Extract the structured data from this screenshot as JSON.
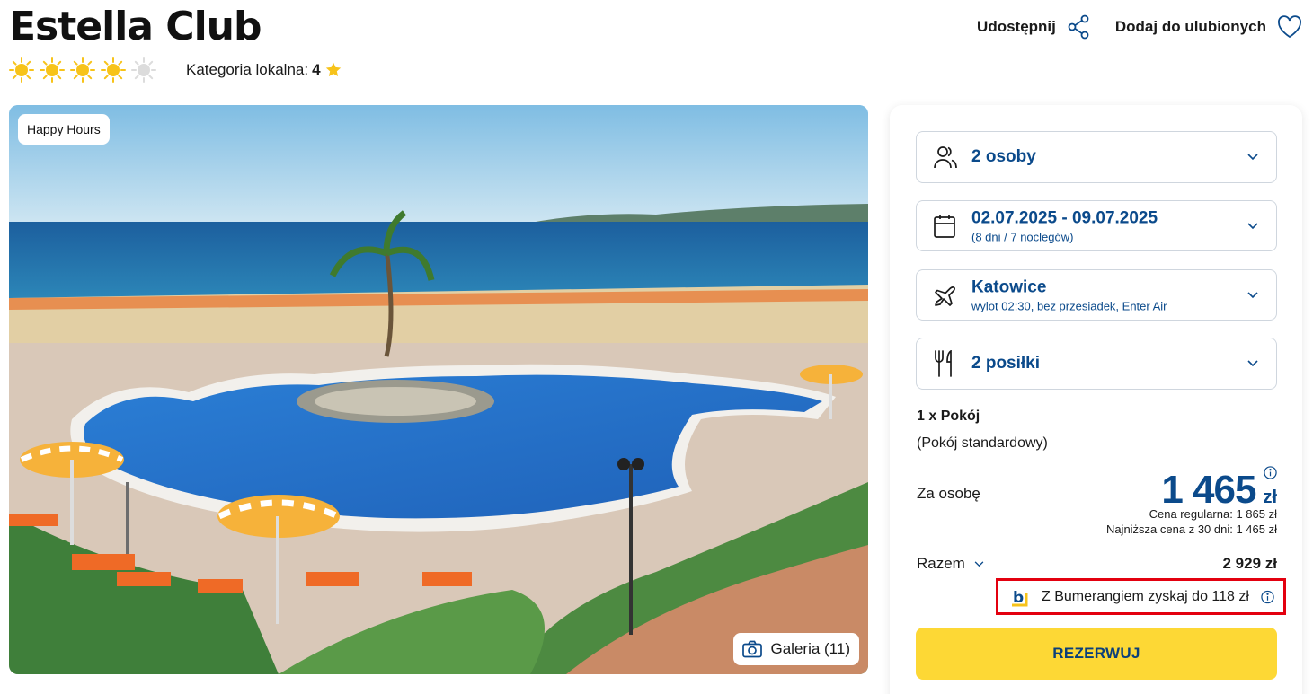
{
  "hotel": {
    "title": "Estella Club",
    "sun_rating": 4,
    "sun_max": 5,
    "local_category_label": "Kategoria lokalna:",
    "local_category_value": "4"
  },
  "header": {
    "share_label": "Udostępnij",
    "favorite_label": "Dodaj do ulubionych"
  },
  "hero": {
    "badge": "Happy Hours",
    "gallery_label": "Galeria (11)"
  },
  "booking": {
    "persons": {
      "main": "2 osoby"
    },
    "dates": {
      "main": "02.07.2025 - 09.07.2025",
      "sub": "(8 dni / 7 noclegów)"
    },
    "flight": {
      "main": "Katowice",
      "sub": "wylot 02:30, bez przesiadek, Enter Air"
    },
    "meals": {
      "main": "2 posiłki"
    },
    "room_count": "1 x Pokój",
    "room_type": "(Pokój standardowy)",
    "per_person_label": "Za osobę",
    "price": "1 465",
    "currency": "zł",
    "regular_label": "Cena regularna:",
    "regular_price": "1 865 zł",
    "lowest_30_days": "Najniższa cena z 30 dni: 1 465 zł",
    "total_label": "Razem",
    "total_value": "2 929 zł",
    "bumerang_text": "Z Bumerangiem zyskaj do 118 zł",
    "reserve_label": "REZERWUJ"
  },
  "colors": {
    "brand_blue": "#0b4a8b",
    "reserve_yellow": "#fdd835",
    "highlight_red": "#e3000f",
    "sun_yellow": "#f7c31a"
  },
  "icons": [
    "share-icon",
    "heart-icon",
    "sun-icon",
    "star-icon",
    "camera-icon",
    "users-icon",
    "calendar-icon",
    "plane-icon",
    "cutlery-icon",
    "chevron-down-icon",
    "info-icon",
    "bumerang-logo-icon"
  ]
}
